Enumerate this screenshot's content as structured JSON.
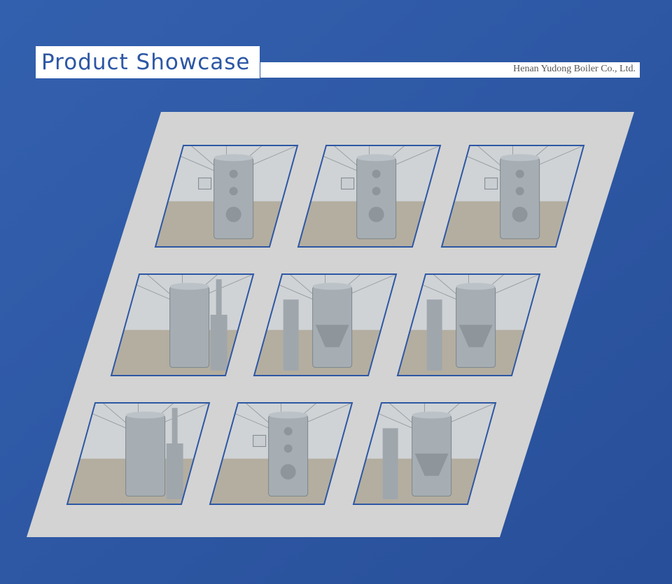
{
  "header": {
    "title": "Product Showcase",
    "company": "Henan Yudong Boiler Co., Ltd."
  },
  "colors": {
    "background": "#2d57a4",
    "panel": "#d3d3d3",
    "title": "#2d57a4",
    "photo_sky": "#cfd3d6",
    "photo_floor": "#b4aea0",
    "boiler": "#a6aeb4"
  },
  "showcase": {
    "rows": 3,
    "columns": 3,
    "photos": [
      {
        "subject": "vertical-boiler-with-control-panel",
        "variant": "v1"
      },
      {
        "subject": "vertical-boiler-with-control-panel",
        "variant": "v2"
      },
      {
        "subject": "vertical-boiler-with-control-panel",
        "variant": "v3"
      },
      {
        "subject": "vertical-boiler-with-chimney-unit",
        "variant": "v4"
      },
      {
        "subject": "vertical-boiler-with-hopper-feeder",
        "variant": "v5"
      },
      {
        "subject": "vertical-boiler-with-hopper-feeder",
        "variant": "v6"
      },
      {
        "subject": "vertical-boiler-with-chimney-unit",
        "variant": "v7"
      },
      {
        "subject": "vertical-boiler-with-control-panel",
        "variant": "v8"
      },
      {
        "subject": "vertical-boiler-with-hopper-feeder",
        "variant": "v9"
      }
    ]
  }
}
